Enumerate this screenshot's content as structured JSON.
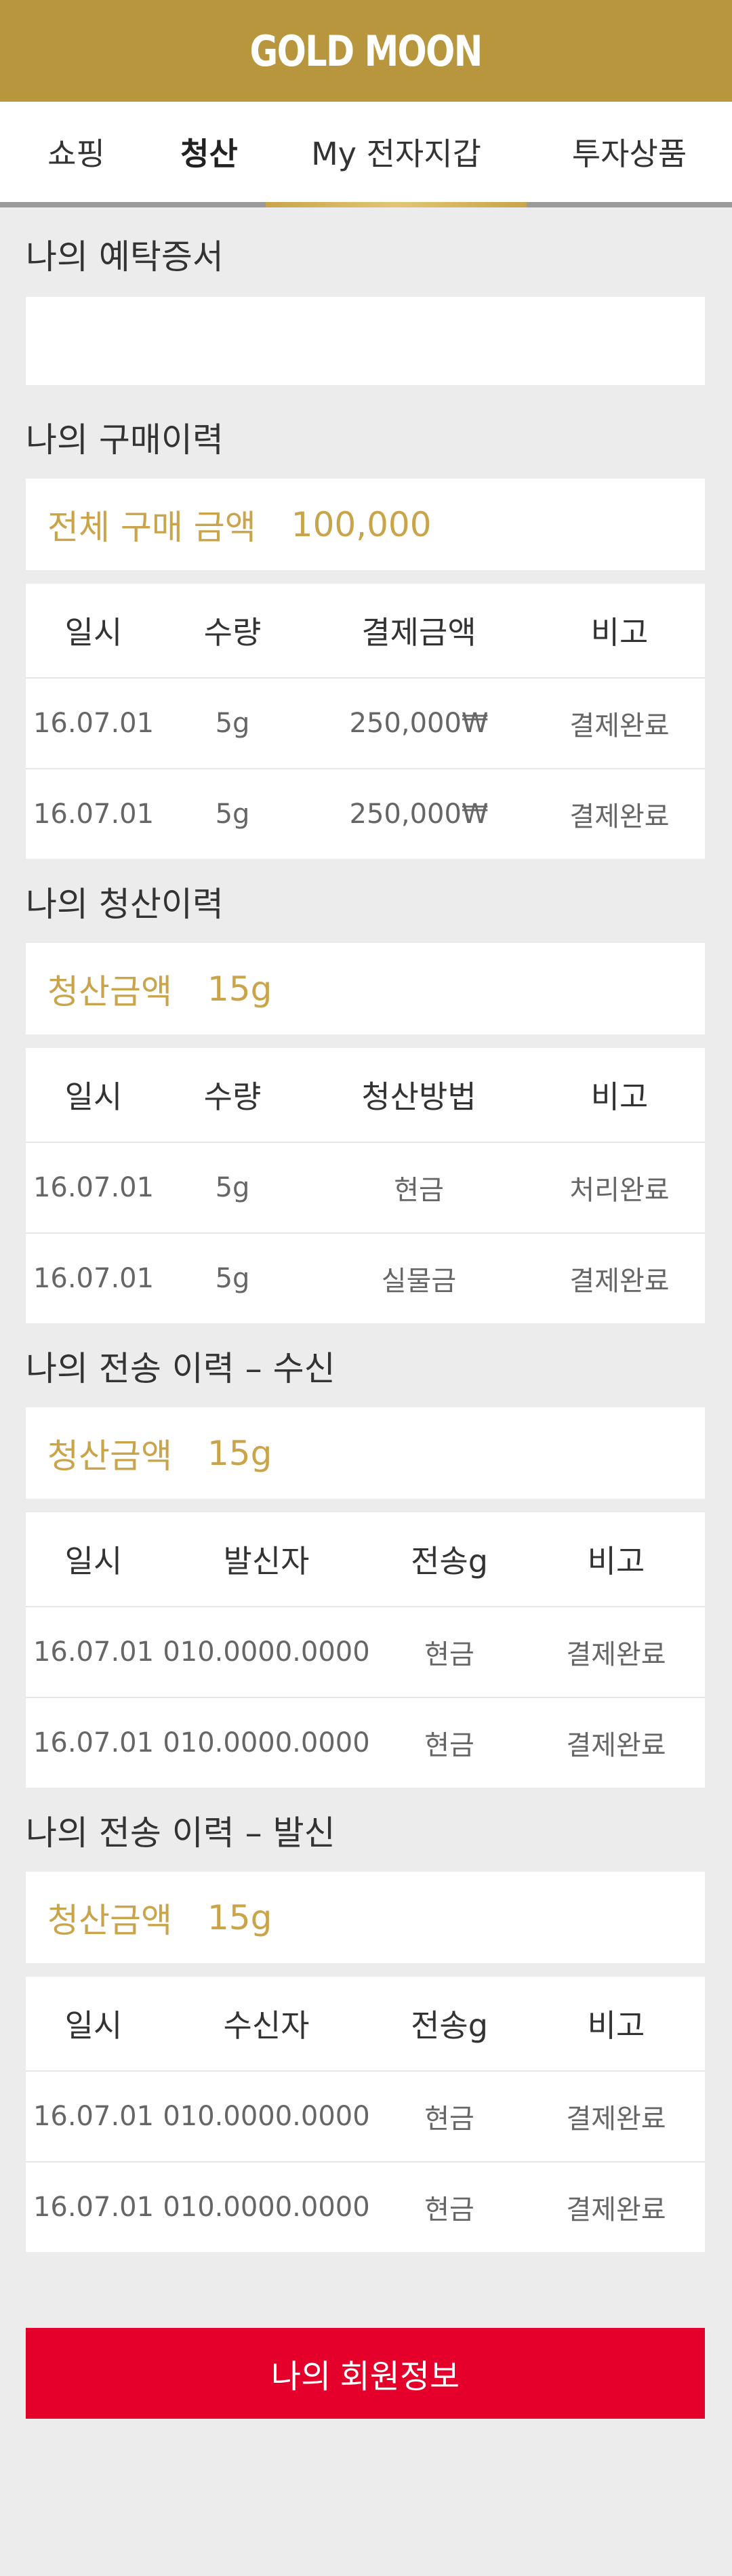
{
  "header": {
    "logo": "GOLD MOON"
  },
  "tabs": [
    "쇼핑",
    "청산",
    "My 전자지갑",
    "투자상품"
  ],
  "deposit": {
    "title": "나의 예탁증서"
  },
  "purchase": {
    "title": "나의 구매이력",
    "summary_label": "전체 구매 금액",
    "summary_value": "100,000",
    "headers": [
      "일시",
      "수량",
      "결제금액",
      "비고"
    ],
    "rows": [
      [
        "16.07.01",
        "5g",
        "250,000₩",
        "결제완료"
      ],
      [
        "16.07.01",
        "5g",
        "250,000₩",
        "결제완료"
      ]
    ]
  },
  "liquidation": {
    "title": "나의 청산이력",
    "summary_label": "청산금액",
    "summary_value": "15g",
    "headers": [
      "일시",
      "수량",
      "청산방법",
      "비고"
    ],
    "rows": [
      [
        "16.07.01",
        "5g",
        "현금",
        "처리완료"
      ],
      [
        "16.07.01",
        "5g",
        "실물금",
        "결제완료"
      ]
    ]
  },
  "transfer_in": {
    "title": "나의 전송 이력 – 수신",
    "summary_label": "청산금액",
    "summary_value": "15g",
    "headers": [
      "일시",
      "발신자",
      "전송g",
      "비고"
    ],
    "rows": [
      [
        "16.07.01",
        "010.0000.0000",
        "현금",
        "결제완료"
      ],
      [
        "16.07.01",
        "010.0000.0000",
        "현금",
        "결제완료"
      ]
    ]
  },
  "transfer_out": {
    "title": "나의 전송 이력 – 발신",
    "summary_label": "청산금액",
    "summary_value": "15g",
    "headers": [
      "일시",
      "수신자",
      "전송g",
      "비고"
    ],
    "rows": [
      [
        "16.07.01",
        "010.0000.0000",
        "현금",
        "결제완료"
      ],
      [
        "16.07.01",
        "010.0000.0000",
        "현금",
        "결제완료"
      ]
    ]
  },
  "member_button": "나의 회원정보"
}
